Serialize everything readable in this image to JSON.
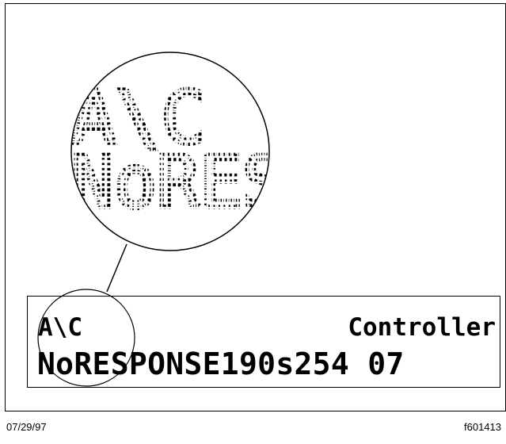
{
  "magnified_view": {
    "line1": "A\\C",
    "line2": "NoRES"
  },
  "display": {
    "line1_left": "A\\C",
    "line1_right": "Controller",
    "line2": "NoRESPONSE190s254 07"
  },
  "footer": {
    "date": "07/29/97",
    "figure_id": "f601413"
  }
}
